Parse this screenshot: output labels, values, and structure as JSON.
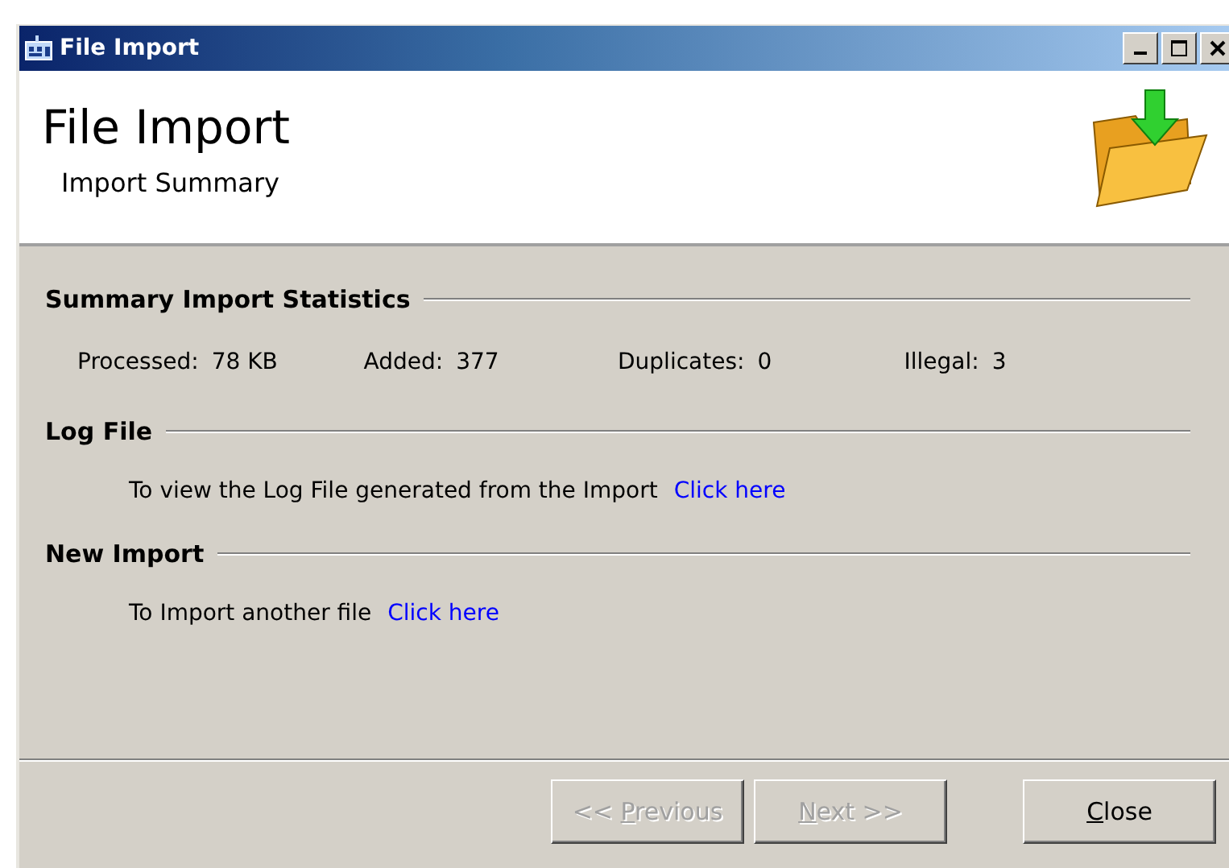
{
  "window": {
    "title": "File Import"
  },
  "header": {
    "title": "File Import",
    "subtitle": "Import Summary"
  },
  "sections": [
    {
      "kind": "stats",
      "title": "Summary Import Statistics",
      "stats": [
        {
          "label": "Processed:",
          "value": "78 KB"
        },
        {
          "label": "Added:",
          "value": "377"
        },
        {
          "label": "Duplicates:",
          "value": "0"
        },
        {
          "label": "Illegal:",
          "value": "3"
        }
      ]
    },
    {
      "kind": "link",
      "title": "Log File",
      "text": "To view the Log File generated from the Import",
      "link": "Click here"
    },
    {
      "kind": "link",
      "title": "New Import",
      "text": "To Import another file",
      "link": "Click here"
    }
  ],
  "buttons": [
    {
      "label_parts": [
        {
          "text": "<< ",
          "underlined": false
        },
        {
          "text": "P",
          "underlined": true
        },
        {
          "text": "revious",
          "underlined": false
        }
      ],
      "disabled": true
    },
    {
      "label_parts": [
        {
          "text": "N",
          "underlined": true
        },
        {
          "text": "ext >>",
          "underlined": false
        }
      ],
      "disabled": true
    },
    {
      "label_parts": [
        {
          "text": "C",
          "underlined": true
        },
        {
          "text": "lose",
          "underlined": false
        }
      ],
      "disabled": false
    }
  ]
}
